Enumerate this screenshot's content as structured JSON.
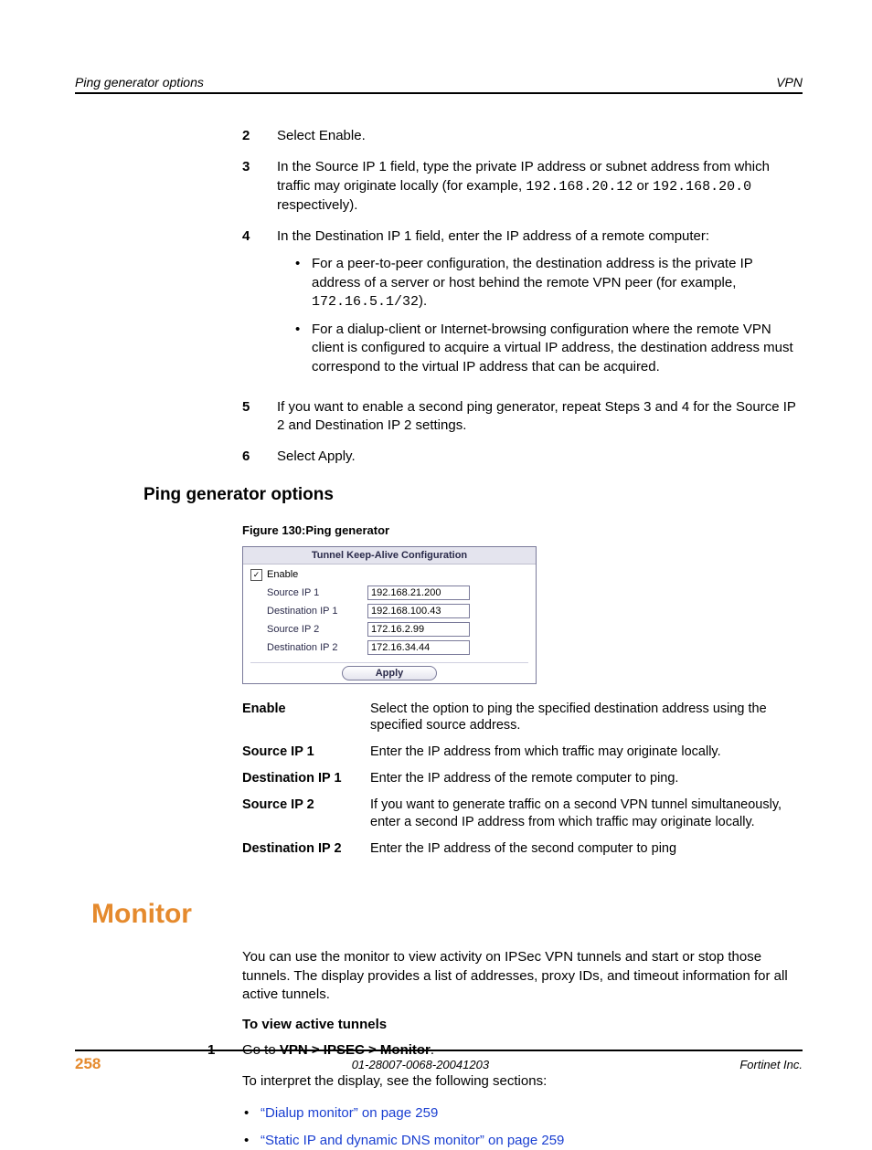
{
  "header": {
    "left": "Ping generator options",
    "right": "VPN"
  },
  "steps": {
    "s2": {
      "num": "2",
      "text": "Select Enable."
    },
    "s3": {
      "num": "3",
      "pre": "In the Source IP 1 field, type the private IP address or subnet address from which traffic may originate locally (for example, ",
      "code1": "192.168.20.12",
      "mid": " or ",
      "code2": "192.168.20.0",
      "post": " respectively)."
    },
    "s4": {
      "num": "4",
      "text": "In the Destination IP 1 field, enter the IP address of a remote computer:"
    },
    "s4b1": {
      "pre": "For a peer-to-peer configuration, the destination address is the private IP address of a server or host behind the remote VPN peer (for example, ",
      "code": "172.16.5.1/32",
      "post": ")."
    },
    "s4b2": "For a dialup-client or Internet-browsing configuration where the remote VPN client is configured to acquire a virtual IP address, the destination address must correspond to the virtual IP address that can be acquired.",
    "s5": {
      "num": "5",
      "text": "If you want to enable a second ping generator, repeat Steps 3 and 4 for the Source IP 2 and Destination IP 2 settings."
    },
    "s6": {
      "num": "6",
      "text": "Select Apply."
    }
  },
  "section_heading": "Ping generator options",
  "figure": {
    "caption": "Figure 130:Ping generator",
    "title": "Tunnel Keep-Alive Configuration",
    "enable_label": "Enable",
    "rows": [
      {
        "label": "Source IP 1",
        "value": "192.168.21.200"
      },
      {
        "label": "Destination IP 1",
        "value": "192.168.100.43"
      },
      {
        "label": "Source IP 2",
        "value": "172.16.2.99"
      },
      {
        "label": "Destination IP 2",
        "value": "172.16.34.44"
      }
    ],
    "apply": "Apply"
  },
  "defs": [
    {
      "term": "Enable",
      "desc": "Select the option to ping the specified destination address using the specified source address."
    },
    {
      "term": "Source IP 1",
      "desc": "Enter the IP address from which traffic may originate locally."
    },
    {
      "term": "Destination IP 1",
      "desc": "Enter the IP address of the remote computer to ping."
    },
    {
      "term": "Source IP 2",
      "desc": "If you want to generate traffic on a second VPN tunnel simultaneously, enter a second IP address from which traffic may originate locally."
    },
    {
      "term": "Destination IP 2",
      "desc": "Enter the IP address of the second computer to ping"
    }
  ],
  "monitor": {
    "heading": "Monitor",
    "intro": "You can use the monitor to view activity on IPSec VPN tunnels and start or stop those tunnels. The display provides a list of addresses, proxy IDs, and timeout information for all active tunnels.",
    "subhead": "To view active tunnels",
    "step1": {
      "num": "1",
      "pre": "Go to ",
      "bold": "VPN > IPSEC > Monitor",
      "post": "."
    },
    "interpret": "To interpret the display, see the following sections:",
    "links": [
      "“Dialup monitor” on page 259",
      "“Static IP and dynamic DNS monitor” on page 259"
    ]
  },
  "footer": {
    "page": "258",
    "mid": "01-28007-0068-20041203",
    "right": "Fortinet Inc."
  }
}
